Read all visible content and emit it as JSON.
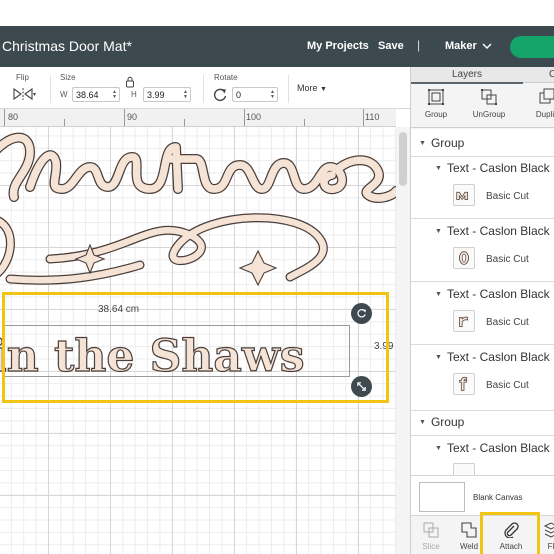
{
  "header": {
    "project_title": "Christmas Door Mat*",
    "my_projects": "My Projects",
    "save": "Save",
    "separator": "|",
    "machine": "Maker"
  },
  "toolbar": {
    "flip_label": "Flip",
    "size_label": "Size",
    "w_label": "W",
    "w_value": "38.64",
    "h_label": "H",
    "h_value": "3.99",
    "rotate_label": "Rotate",
    "rotate_value": "0",
    "more_label": "More"
  },
  "ruler": {
    "marks": [
      "80",
      "90",
      "100",
      "110"
    ]
  },
  "canvas": {
    "selected_text": "in the Shaws",
    "width_readout": "38.64 cm",
    "height_readout": "3.99"
  },
  "layers_panel": {
    "tabs": [
      "Layers",
      "C"
    ],
    "actions": [
      "Group",
      "UnGroup",
      "Duplic"
    ],
    "groups": [
      {
        "label": "Group",
        "items": [
          {
            "label": "Text - Caslon Black",
            "cut": "Basic Cut"
          },
          {
            "label": "Text - Caslon Black",
            "cut": "Basic Cut"
          },
          {
            "label": "Text - Caslon Black",
            "cut": "Basic Cut"
          },
          {
            "label": "Text - Caslon Black",
            "cut": "Basic Cut"
          }
        ]
      },
      {
        "label": "Group",
        "items": [
          {
            "label": "Text - Caslon Black",
            "cut": ""
          }
        ]
      }
    ],
    "blank_canvas": "Blank Canvas",
    "bottom_actions": [
      "Slice",
      "Weld",
      "Attach",
      "Fl"
    ]
  },
  "colors": {
    "header_bg": "#3c4a50",
    "make_button": "#14a46a",
    "highlight": "#f2c414",
    "text_fill": "#f5e3d6"
  }
}
